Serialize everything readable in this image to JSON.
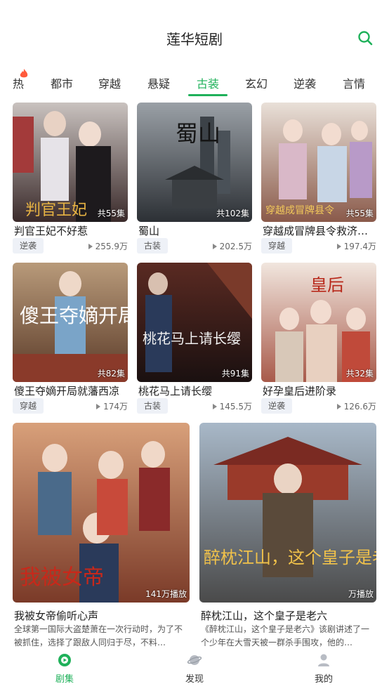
{
  "header": {
    "title": "莲华短剧",
    "search_icon": "search-icon"
  },
  "tabs": [
    {
      "label": "热",
      "active": false
    },
    {
      "label": "都市",
      "active": false
    },
    {
      "label": "穿越",
      "active": false
    },
    {
      "label": "悬疑",
      "active": false
    },
    {
      "label": "古装",
      "active": true
    },
    {
      "label": "玄幻",
      "active": false
    },
    {
      "label": "逆袭",
      "active": false
    },
    {
      "label": "言情",
      "active": false
    }
  ],
  "grid": [
    {
      "title": "判官王妃不好惹",
      "tag": "逆袭",
      "views": "255.9万",
      "episodes": "共55集",
      "poster_text": "判官王妃"
    },
    {
      "title": "蜀山",
      "tag": "古装",
      "views": "202.5万",
      "episodes": "共102集",
      "poster_text": "蜀山"
    },
    {
      "title": "穿越成冒牌县令救济…",
      "tag": "穿越",
      "views": "197.4万",
      "episodes": "共55集",
      "poster_text": "穿越成冒牌县令"
    },
    {
      "title": "傻王夺嫡开局就藩西凉",
      "tag": "穿越",
      "views": "174万",
      "episodes": "共82集",
      "poster_text": "傻王夺嫡开局"
    },
    {
      "title": "桃花马上请长缨",
      "tag": "古装",
      "views": "145.5万",
      "episodes": "共91集",
      "poster_text": "桃花马上请长缨"
    },
    {
      "title": "好孕皇后进阶录",
      "tag": "逆袭",
      "views": "126.6万",
      "episodes": "共32集",
      "poster_text": "皇后"
    }
  ],
  "featured": [
    {
      "title": "我被女帝偷听心声",
      "desc": "全球第一国际大盗楚萧在一次行动时，为了不被抓住，选择了跟敌人同归于尽，不料…",
      "poster_text": "我被女帝",
      "overlay": "141万播放"
    },
    {
      "title": "醉枕江山，这个皇子是老六",
      "desc": "《醉枕江山，这个皇子是老六》该剧讲述了一个少年在大雪天被一群杀手围攻，他的…",
      "poster_text": "醉枕江山，这个皇子是老六",
      "overlay": "万播放"
    }
  ],
  "bottom_nav": [
    {
      "label": "剧集",
      "icon": "play-circle-icon",
      "active": true
    },
    {
      "label": "发现",
      "icon": "planet-icon",
      "active": false
    },
    {
      "label": "我的",
      "icon": "user-icon",
      "active": false
    }
  ],
  "colors": {
    "accent": "#1fb15a",
    "tag_bg": "#eef1f7",
    "hot": "#ff5a3c"
  }
}
